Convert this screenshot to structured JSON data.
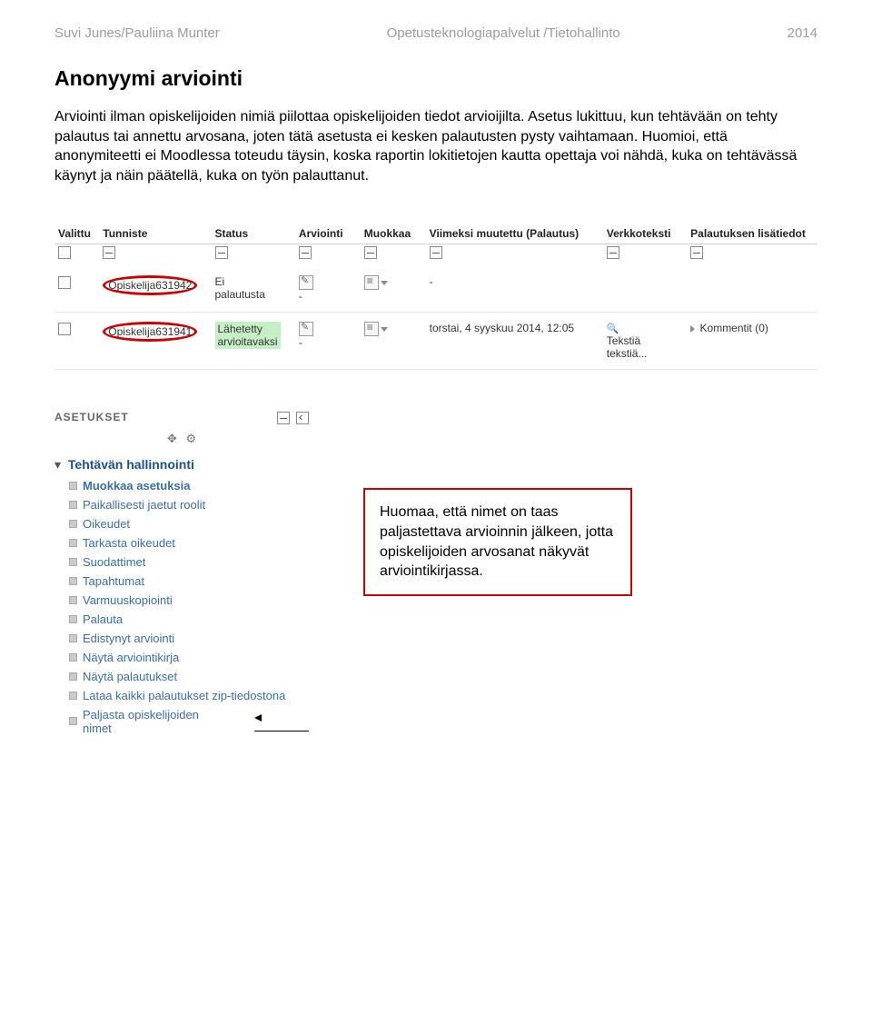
{
  "header": {
    "left": "Suvi Junes/Pauliina Munter",
    "center": "Opetusteknologiapalvelut /Tietohallinto",
    "right": "2014"
  },
  "title": "Anonyymi arviointi",
  "body": "Arviointi ilman opiskelijoiden nimiä piilottaa opiskelijoiden tiedot arvioijilta. Asetus lukittuu, kun tehtävään on tehty palautus tai annettu arvosana, joten tätä asetusta ei kesken palautusten pysty vaihtamaan. Huomioi, että anonymiteetti ei Moodlessa toteudu täysin, koska raportin lokitietojen kautta opettaja voi nähdä, kuka on tehtävässä käynyt ja näin päätellä, kuka on työn palauttanut.",
  "grading": {
    "columns": {
      "valittu": "Valittu",
      "tunniste": "Tunniste",
      "status": "Status",
      "arviointi": "Arviointi",
      "muokkaa": "Muokkaa",
      "muutettu": "Viimeksi muutettu (Palautus)",
      "verkkoteksti": "Verkkoteksti",
      "lisatiedot": "Palautuksen lisätiedot"
    },
    "rows": [
      {
        "tunniste": "Opiskelija631942",
        "status": "Ei palautusta",
        "arviointi": "-",
        "muutettu": "-",
        "verkkoteksti": "",
        "lisatiedot": ""
      },
      {
        "tunniste": "Opiskelija631941",
        "status": "Lähetetty arvioitavaksi",
        "arviointi": "-",
        "muutettu": "torstai, 4 syyskuu 2014, 12:05",
        "verkkoteksti": "Tekstiä tekstiä...",
        "lisatiedot": "Kommentit (0)"
      }
    ]
  },
  "settings": {
    "title": "ASETUKSET",
    "root": "Tehtävän hallinnointi",
    "items": [
      "Muokkaa asetuksia",
      "Paikallisesti jaetut roolit",
      "Oikeudet",
      "Tarkasta oikeudet",
      "Suodattimet",
      "Tapahtumat",
      "Varmuuskopiointi",
      "Palauta",
      "Edistynyt arviointi",
      "Näytä arviointikirja",
      "Näytä palautukset",
      "Lataa kaikki palautukset zip-tiedostona",
      "Paljasta opiskelijoiden nimet"
    ]
  },
  "callout": "Huomaa, että nimet on taas paljastettava arvioinnin jälkeen, jotta opiskelijoiden arvosanat näkyvät arviointikirjassa."
}
